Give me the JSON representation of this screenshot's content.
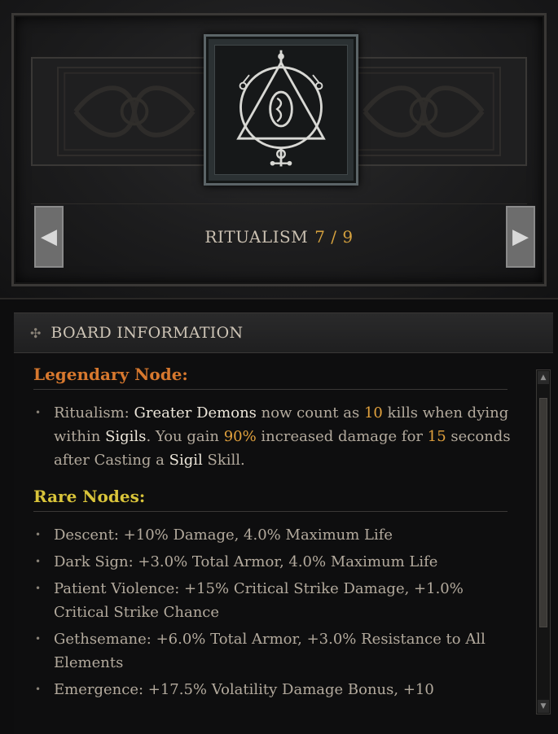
{
  "board": {
    "name": "RITUALISM",
    "count": "7 / 9",
    "emblem_icon": "sigil-glyph-icon",
    "prev_icon": "◀",
    "next_icon": "▶"
  },
  "info": {
    "icon": "✣",
    "header": "BOARD INFORMATION",
    "legendary_title": "Legendary Node:",
    "legendary": {
      "name": "Ritualism:",
      "t1": "Greater Demons",
      "t2": " now count as ",
      "t3": "10",
      "t4": " kills when dying within ",
      "t5": "Sigils",
      "t6": ". You gain ",
      "t7": "90%",
      "t8": " increased damage for ",
      "t9": "15",
      "t10": " seconds after Casting a ",
      "t11": "Sigil",
      "t12": " Skill."
    },
    "rare_title": "Rare Nodes:",
    "rare_nodes": [
      "Descent: +10% Damage, 4.0% Maximum Life",
      "Dark Sign: +3.0% Total Armor, 4.0% Maximum Life",
      "Patient Violence: +15% Critical Strike Damage, +1.0% Critical Strike Chance",
      "Gethsemane: +6.0% Total Armor, +3.0% Resistance to All Elements",
      "Emergence: +17.5% Volatility Damage Bonus, +10"
    ],
    "bullet": "•",
    "scroll_up": "▲",
    "scroll_down": "▼"
  },
  "colors": {
    "legendary": "#d7782e",
    "rare": "#d9c43a",
    "highlight_number": "#e1a13d",
    "highlight_term": "#ece6da"
  }
}
